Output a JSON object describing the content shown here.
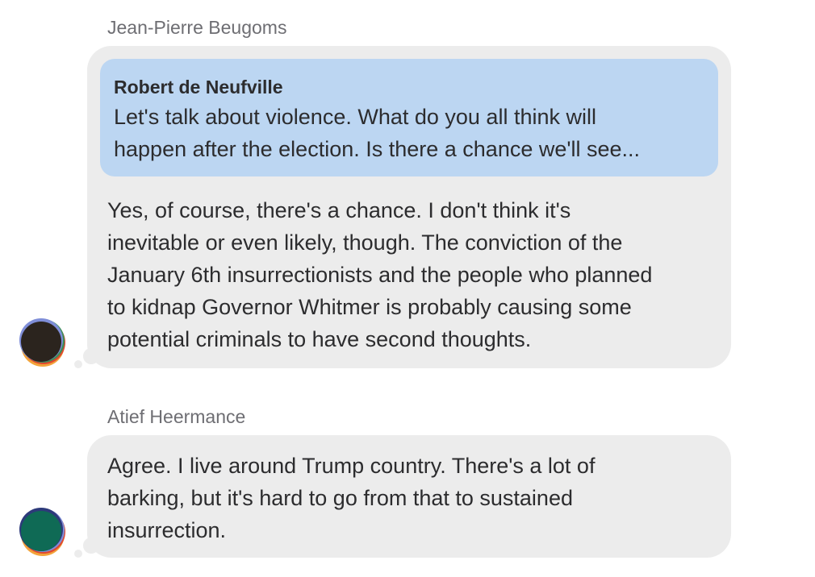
{
  "messages": [
    {
      "sender": "Jean-Pierre Beugoms",
      "avatar_icon": "abstract-avatar-icon",
      "avatar_color": "#2b241e",
      "quote": {
        "author": "Robert de Neufville",
        "lines": [
          "Let's talk about violence. What do you all think will",
          "happen after the election. Is there a chance we'll see..."
        ]
      },
      "lines": [
        "Yes, of course, there's a chance. I don't think it's",
        "inevitable or even likely, though. The conviction of the",
        "January 6th insurrectionists and the people who planned",
        "to kidnap Governor Whitmer is probably causing some",
        "potential criminals to have second thoughts."
      ]
    },
    {
      "sender": "Atief Heermance",
      "avatar_icon": "abstract-avatar-icon",
      "avatar_color": "#0f6a55",
      "lines": [
        "Agree. I live around Trump country. There's a lot of",
        "barking, but it's hard to go from that to sustained",
        "insurrection."
      ]
    }
  ],
  "colors": {
    "bubble": "#ececec",
    "quote_background": "#bcd6f2",
    "sender_name": "#6e6e73",
    "text": "#2c2c2e"
  }
}
